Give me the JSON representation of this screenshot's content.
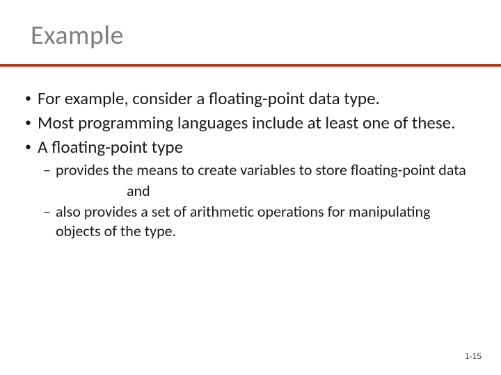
{
  "title": "Example",
  "bullets": [
    "For example, consider a floating-point data type.",
    "Most programming languages include at least one of these.",
    "A floating-point type"
  ],
  "sub": {
    "item1": "provides the means to create variables to store floating-point data",
    "and": "and",
    "item2": "also provides a set of arithmetic operations for manipulating objects of the type."
  },
  "pagenum": "1-15"
}
